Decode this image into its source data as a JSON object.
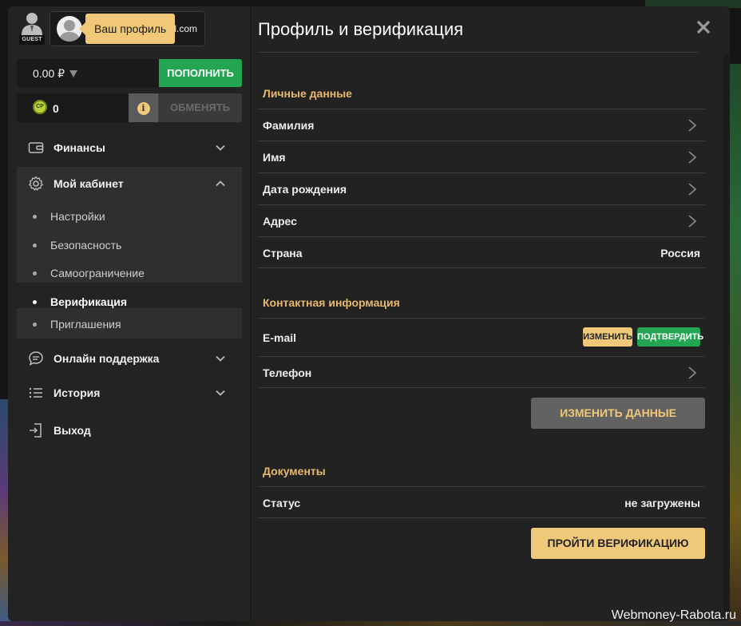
{
  "colors": {
    "accent_green": "#24a552",
    "accent_gold": "#efc87a",
    "section_gold": "#e7b96c",
    "panel": "#222222"
  },
  "sidebar": {
    "guest_badge": "GUEST",
    "email_partial": "ail.com",
    "profile_tooltip": "Ваш профиль",
    "balance": "0.00 ₽",
    "deposit_label": "ПОПОЛНИТЬ",
    "cp_icon_text": "CP",
    "cp_value": "0",
    "info_icon": "i",
    "exchange_label": "ОБМЕНЯТЬ",
    "nav": {
      "finance": {
        "label": "Финансы",
        "icon": "wallet-icon"
      },
      "cabinet": {
        "label": "Мой кабинет",
        "icon": "gear-icon"
      },
      "support": {
        "label": "Онлайн поддержка",
        "icon": "chat-icon"
      },
      "history": {
        "label": "История",
        "icon": "list-icon"
      },
      "logout": {
        "label": "Выход",
        "icon": "logout-icon"
      }
    },
    "cabinet_items": {
      "settings": "Настройки",
      "security": "Безопасность",
      "self_limit": "Самоограничение",
      "verification": "Верификация",
      "invites": "Приглашения"
    }
  },
  "main": {
    "title": "Профиль и верификация",
    "personal": {
      "title": "Личные данные",
      "surname": "Фамилия",
      "name": "Имя",
      "birthdate": "Дата рождения",
      "address": "Адрес",
      "country_label": "Страна",
      "country_value": "Россия"
    },
    "contact": {
      "title": "Контактная информация",
      "email_label": "E-mail",
      "change_label": "ИЗМЕНИТЬ",
      "confirm_label": "ПОДТВЕРДИТЬ",
      "phone_label": "Телефон"
    },
    "edit_data_label": "ИЗМЕНИТЬ ДАННЫЕ",
    "documents": {
      "title": "Документы",
      "status_label": "Статус",
      "status_value": "не загружены"
    },
    "verify_label": "ПРОЙТИ ВЕРИФИКАЦИЮ"
  },
  "watermark": "Webmoney-Rabota.ru"
}
